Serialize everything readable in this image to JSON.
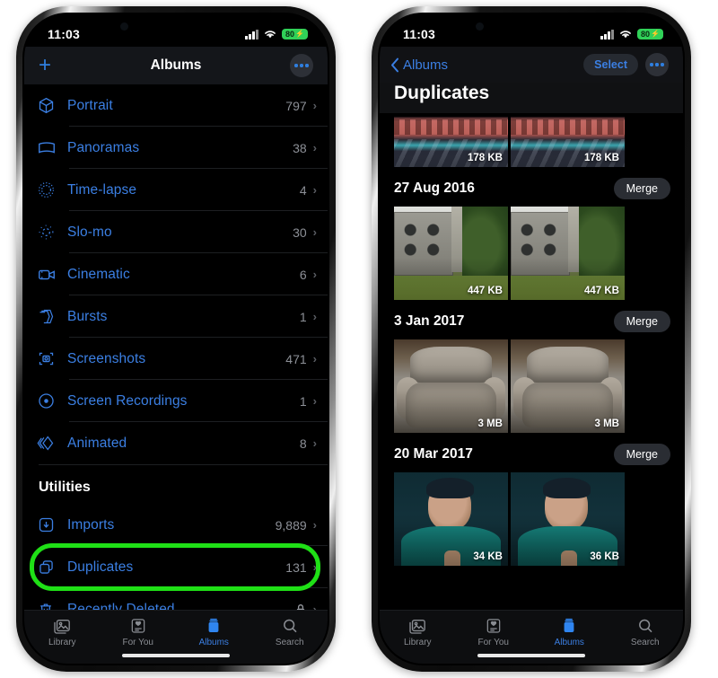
{
  "status_bar": {
    "time": "11:03",
    "battery_level": "80",
    "battery_charging_glyph": "⚡",
    "cellular_icon": "signal-bars-icon",
    "wifi_icon": "wifi-icon"
  },
  "left_phone": {
    "nav": {
      "add_label": "+",
      "title": "Albums",
      "more_label": "more-options"
    },
    "media_types": [
      {
        "icon": "portrait-cube-icon",
        "label": "Portrait",
        "count": "797"
      },
      {
        "icon": "panorama-icon",
        "label": "Panoramas",
        "count": "38"
      },
      {
        "icon": "timelapse-icon",
        "label": "Time-lapse",
        "count": "4"
      },
      {
        "icon": "slomo-icon",
        "label": "Slo-mo",
        "count": "30"
      },
      {
        "icon": "cinematic-icon",
        "label": "Cinematic",
        "count": "6"
      },
      {
        "icon": "bursts-icon",
        "label": "Bursts",
        "count": "1"
      },
      {
        "icon": "screenshots-icon",
        "label": "Screenshots",
        "count": "471"
      },
      {
        "icon": "screen-recordings-icon",
        "label": "Screen Recordings",
        "count": "1"
      },
      {
        "icon": "animated-icon",
        "label": "Animated",
        "count": "8"
      }
    ],
    "utilities": {
      "header": "Utilities",
      "items": [
        {
          "icon": "imports-icon",
          "label": "Imports",
          "count": "9,889",
          "highlighted": false,
          "locked": false
        },
        {
          "icon": "duplicates-icon",
          "label": "Duplicates",
          "count": "131",
          "highlighted": true,
          "locked": false
        },
        {
          "icon": "trash-icon",
          "label": "Recently Deleted",
          "count": "",
          "highlighted": false,
          "locked": true
        }
      ]
    },
    "highlight_color": "#1fe016"
  },
  "right_phone": {
    "nav": {
      "back_label": "Albums",
      "select_label": "Select",
      "more_label": "more-options",
      "title": "Duplicates"
    },
    "groups": [
      {
        "date": "",
        "merge_label": "",
        "partial": true,
        "scene": "street",
        "photos": [
          {
            "size": "178 KB"
          },
          {
            "size": "178 KB"
          }
        ]
      },
      {
        "date": "27 Aug 2016",
        "merge_label": "Merge",
        "partial": false,
        "scene": "campus",
        "photos": [
          {
            "size": "447 KB"
          },
          {
            "size": "447 KB"
          }
        ]
      },
      {
        "date": "3 Jan 2017",
        "merge_label": "Merge",
        "partial": false,
        "scene": "chair",
        "photos": [
          {
            "size": "3 MB"
          },
          {
            "size": "3 MB"
          }
        ]
      },
      {
        "date": "20 Mar 2017",
        "merge_label": "Merge",
        "partial": false,
        "scene": "man",
        "photos": [
          {
            "size": "34 KB"
          },
          {
            "size": "36 KB"
          }
        ]
      }
    ]
  },
  "tab_bar": {
    "tabs": [
      {
        "icon": "library-icon",
        "label": "Library",
        "active": false
      },
      {
        "icon": "for-you-icon",
        "label": "For You",
        "active": false
      },
      {
        "icon": "albums-icon",
        "label": "Albums",
        "active": true
      },
      {
        "icon": "search-icon",
        "label": "Search",
        "active": false
      }
    ],
    "active_color": "#3b7fe3"
  }
}
